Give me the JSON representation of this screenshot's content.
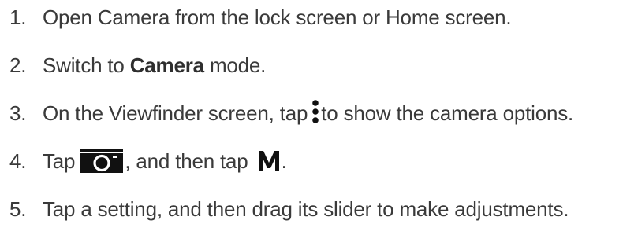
{
  "steps": [
    {
      "number": "1.",
      "text": "Open Camera from the lock screen or Home screen."
    },
    {
      "number": "2.",
      "before": "Switch to ",
      "bold": "Camera",
      "after": " mode."
    },
    {
      "number": "3.",
      "before": "On the Viewfinder screen, tap ",
      "icon": "more-options-vertical-dots-icon",
      "after": "to show the camera options."
    },
    {
      "number": "4.",
      "before": "Tap ",
      "icon_1": "camera-mode-icon",
      "middle": ", and then tap ",
      "icon_2": "manual-mode-m-icon",
      "after": "."
    },
    {
      "number": "5.",
      "text": "Tap a setting, and then drag its slider to make adjustments."
    }
  ]
}
